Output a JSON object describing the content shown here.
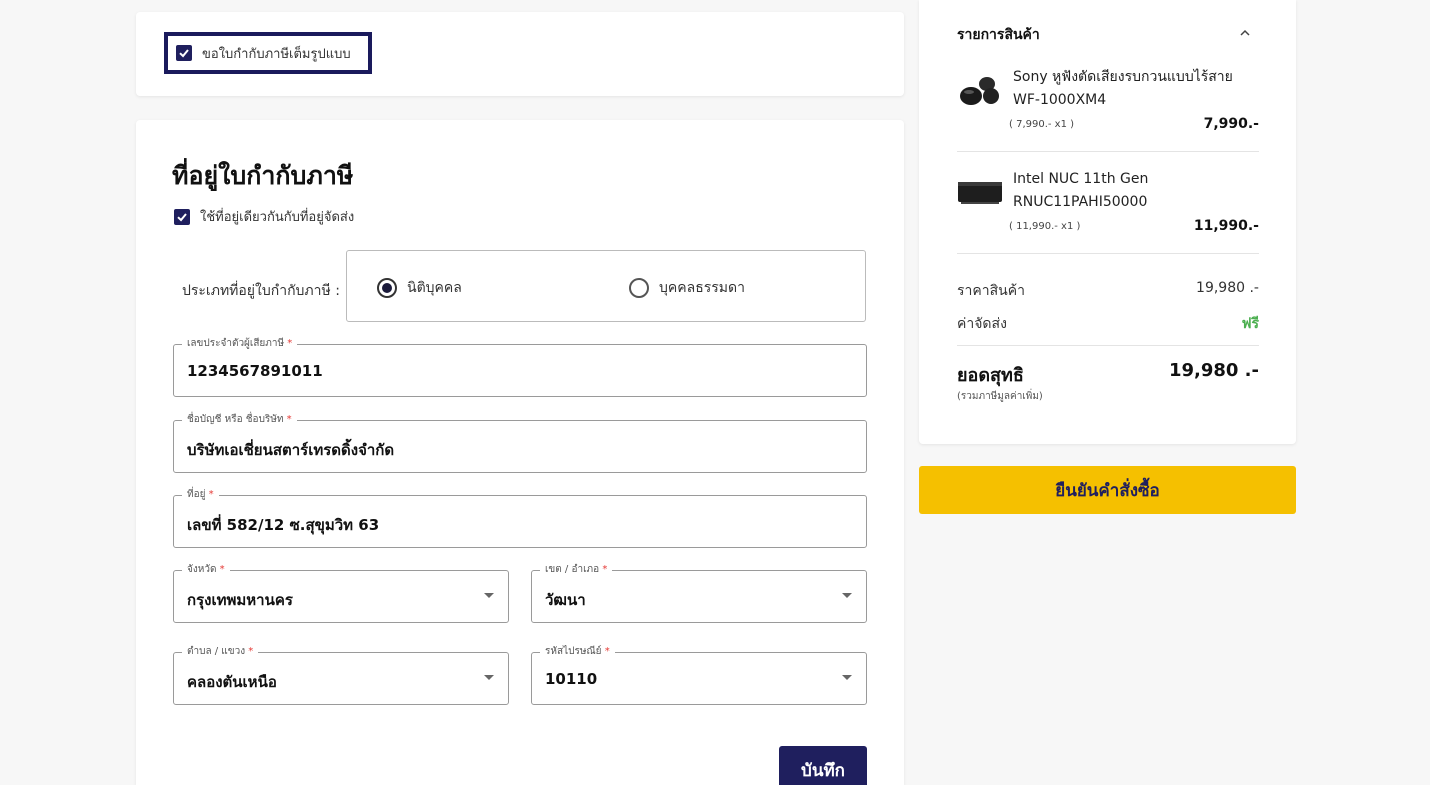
{
  "full_invoice": {
    "label": "ขอใบกำกับภาษีเต็มรูปแบบ",
    "checked": true
  },
  "tax_address": {
    "title": "ที่อยู่ใบกำกับภาษี",
    "same_as_shipping_label": "ใช้ที่อยู่เดียวกันกับที่อยู่จัดส่ง",
    "type_label": "ประเภทที่อยู่ใบกำกับภาษี :",
    "type_options": [
      "นิติบุคคล",
      "บุคคลธรรมดา"
    ],
    "type_selected": "นิติบุคคล",
    "fields": {
      "tax_id": {
        "label": "เลขประจำตัวผู้เสียภาษี",
        "value": "1234567891011"
      },
      "company": {
        "label": "ชื่อบัญชี หรือ ชื่อบริษัท",
        "value": "บริษัทเอเชี่ยนสตาร์เทรดดิ้งจำกัด"
      },
      "address": {
        "label": "ที่อยู่",
        "value": "เลขที่ 582/12 ซ.สุขุมวิท 63"
      },
      "province": {
        "label": "จังหวัด",
        "value": "กรุงเทพมหานคร"
      },
      "district": {
        "label": "เขต / อำเภอ",
        "value": "วัฒนา"
      },
      "subdistrict": {
        "label": "ตำบล / แขวง",
        "value": "คลองตันเหนือ"
      },
      "postcode": {
        "label": "รหัสไปรษณีย์",
        "value": "10110"
      }
    },
    "required_mark": "*",
    "save_label": "บันทึก"
  },
  "summary": {
    "header": "รายการสินค้า",
    "items": [
      {
        "name": "Sony หูฟังตัดเสียงรบกวนแบบไร้สาย WF-1000XM4",
        "unit": "( 7,990.- x1 )",
        "price": "7,990.-"
      },
      {
        "name": "Intel NUC 11th Gen RNUC11PAHI50000",
        "unit": "( 11,990.- x1 )",
        "price": "11,990.-"
      }
    ],
    "subtotal_label": "ราคาสินค้า",
    "subtotal_value": "19,980 .-",
    "shipping_label": "ค่าจัดส่ง",
    "shipping_value": "ฟรี",
    "total_label": "ยอดสุทธิ",
    "total_note": "(รวมภาษีมูลค่าเพิ่ม)",
    "total_value": "19,980 .-"
  },
  "confirm_label": "ยืนยันคำสั่งซื้อ",
  "colors": {
    "navy": "#1f1f5e",
    "yellow": "#f5c000",
    "free_green": "#4caf50"
  }
}
